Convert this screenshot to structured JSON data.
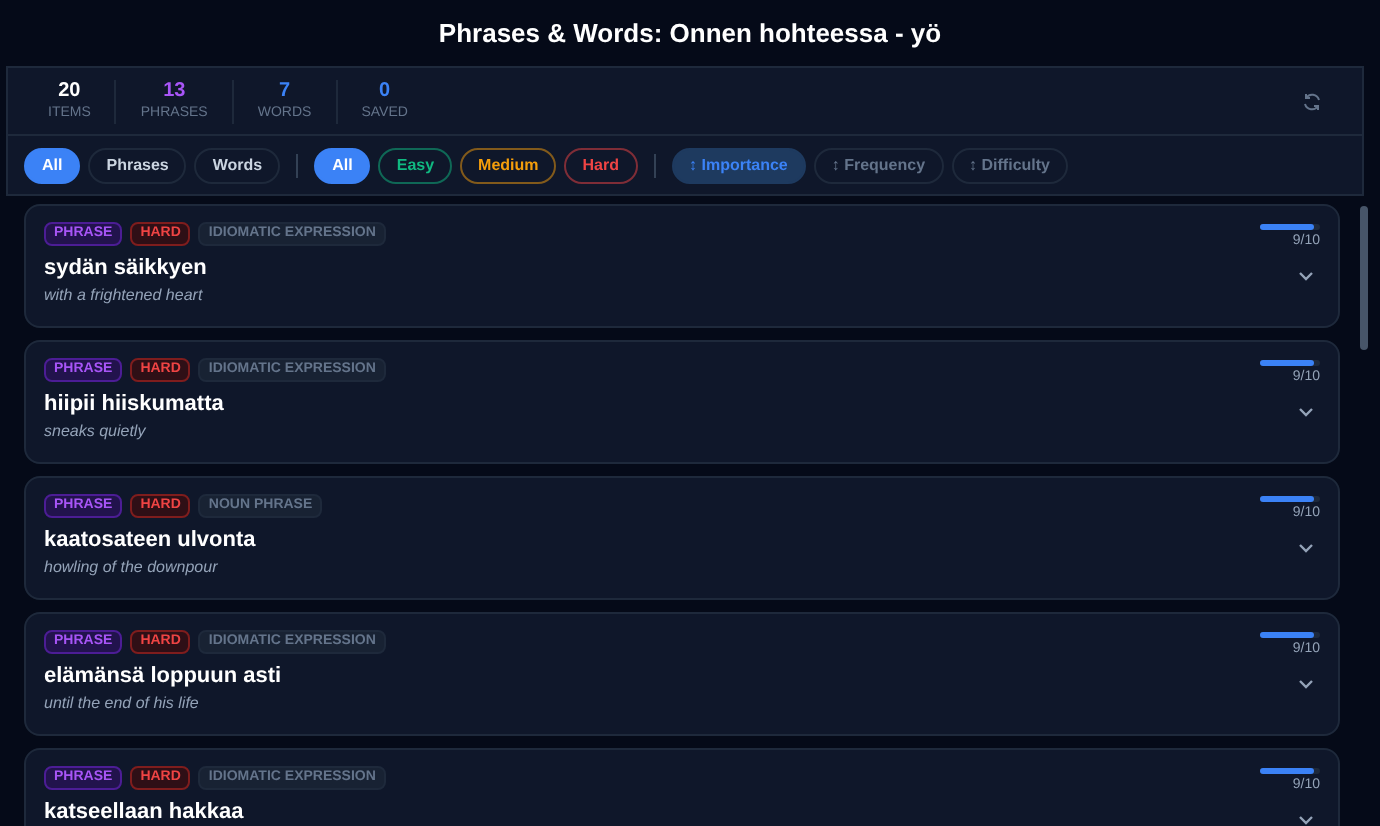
{
  "window": {
    "title": "Phrases & Words: Onnen hohteessa - yö"
  },
  "stats": [
    {
      "value": "20",
      "label": "ITEMS",
      "color": "#ffffff"
    },
    {
      "value": "13",
      "label": "PHRASES",
      "color": "#a855f7"
    },
    {
      "value": "7",
      "label": "WORDS",
      "color": "#3b82f6"
    },
    {
      "value": "0",
      "label": "SAVED",
      "color": "#3b82f6"
    }
  ],
  "type_filters": [
    {
      "label": "All",
      "selected": true
    },
    {
      "label": "Phrases",
      "selected": false
    },
    {
      "label": "Words",
      "selected": false
    }
  ],
  "difficulty_filters": [
    {
      "label": "All",
      "kind": "all",
      "selected": true
    },
    {
      "label": "Easy",
      "kind": "easy",
      "selected": false
    },
    {
      "label": "Medium",
      "kind": "medium",
      "selected": false
    },
    {
      "label": "Hard",
      "kind": "hard",
      "selected": false
    }
  ],
  "sort_options": [
    {
      "label": "↕ Importance",
      "selected": true
    },
    {
      "label": "↕ Frequency",
      "selected": false
    },
    {
      "label": "↕ Difficulty",
      "selected": false
    }
  ],
  "items": [
    {
      "type": "PHRASE",
      "difficulty": "HARD",
      "category": "IDIOMATIC EXPRESSION",
      "term": "sydän säikkyen",
      "translation": "with a frightened heart",
      "level": 0.9,
      "score": "9/10"
    },
    {
      "type": "PHRASE",
      "difficulty": "HARD",
      "category": "IDIOMATIC EXPRESSION",
      "term": "hiipii hiiskumatta",
      "translation": "sneaks quietly",
      "level": 0.9,
      "score": "9/10"
    },
    {
      "type": "PHRASE",
      "difficulty": "HARD",
      "category": "NOUN PHRASE",
      "term": "kaatosateen ulvonta",
      "translation": "howling of the downpour",
      "level": 0.9,
      "score": "9/10"
    },
    {
      "type": "PHRASE",
      "difficulty": "HARD",
      "category": "IDIOMATIC EXPRESSION",
      "term": "elämänsä loppuun asti",
      "translation": "until the end of his life",
      "level": 0.9,
      "score": "9/10"
    },
    {
      "type": "PHRASE",
      "difficulty": "HARD",
      "category": "IDIOMATIC EXPRESSION",
      "term": "katseellaan hakkaa",
      "level": 0.9,
      "score": "9/10"
    }
  ]
}
